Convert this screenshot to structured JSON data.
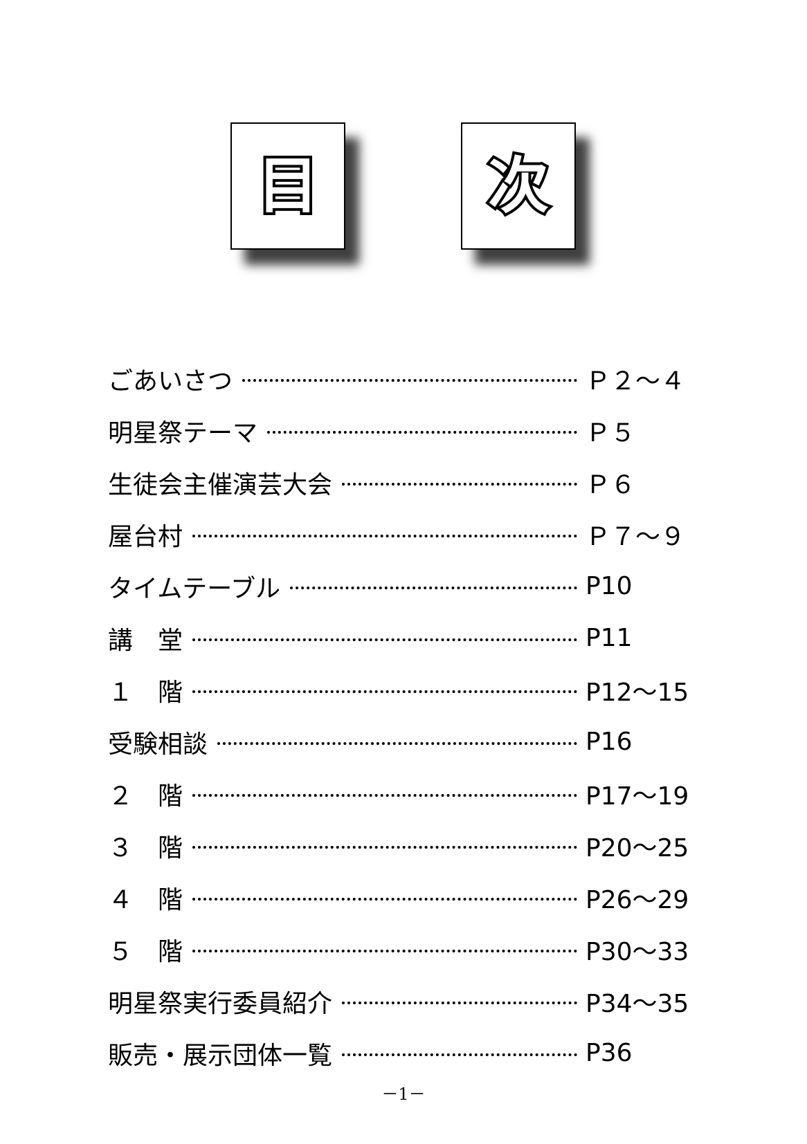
{
  "title": {
    "char1": "目",
    "char2": "次"
  },
  "toc": [
    {
      "label": "ごあいさつ",
      "page": "Ｐ２～４"
    },
    {
      "label": "明星祭テーマ",
      "page": "Ｐ５"
    },
    {
      "label": "生徒会主催演芸大会",
      "page": "Ｐ６"
    },
    {
      "label": "屋台村",
      "page": "Ｐ７～９"
    },
    {
      "label": "タイムテーブル",
      "page": "P10"
    },
    {
      "label": "講　堂",
      "page": "P11"
    },
    {
      "label": "１　階",
      "page": "P12～15"
    },
    {
      "label": "受験相談",
      "page": "P16"
    },
    {
      "label": "２　階",
      "page": "P17～19"
    },
    {
      "label": "３　階",
      "page": "P20～25"
    },
    {
      "label": "４　階",
      "page": "P26～29"
    },
    {
      "label": "５　階",
      "page": "P30～33"
    },
    {
      "label": "明星祭実行委員紹介",
      "page": "P34～35"
    },
    {
      "label": "販売・展示団体一覧",
      "page": "P36"
    }
  ],
  "footer": {
    "page_number": "－1－"
  }
}
